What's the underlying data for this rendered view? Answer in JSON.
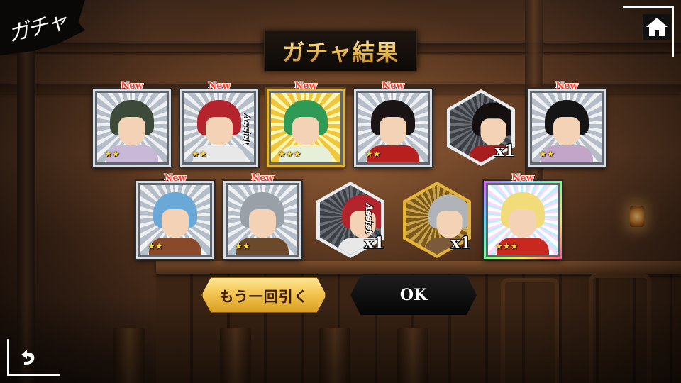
{
  "screen": {
    "title": "ガチャ",
    "results_title": "ガチャ結果"
  },
  "nav": {
    "home_icon": "home-icon",
    "back_icon": "back-arrow-icon"
  },
  "colors": {
    "gold": "#e2b53a",
    "new_badge": "#ff3a2a",
    "star": "#ffd53a"
  },
  "row1": [
    {
      "kind": "card",
      "new": "New",
      "stars": "★★",
      "rarity": "silver",
      "hair": "#3d4a3a",
      "body": "#c9b8d8",
      "assist": ""
    },
    {
      "kind": "card",
      "new": "New",
      "stars": "★★",
      "rarity": "silver",
      "hair": "#b4242c",
      "body": "#e8e8e8",
      "assist": "Assist"
    },
    {
      "kind": "card",
      "new": "New",
      "stars": "★★★",
      "rarity": "gold",
      "hair": "#2f9a55",
      "body": "#e6f0d8",
      "assist": ""
    },
    {
      "kind": "card",
      "new": "New",
      "stars": "★★",
      "rarity": "silver",
      "hair": "#1a1414",
      "body": "#b82020",
      "assist": ""
    },
    {
      "kind": "hex",
      "count": "x1",
      "rarity": "silver",
      "hair": "#141010",
      "body": "#a81e1e"
    },
    {
      "kind": "card",
      "new": "New",
      "stars": "★★",
      "rarity": "silver",
      "hair": "#151515",
      "body": "#c2a5c8",
      "assist": ""
    }
  ],
  "row2": [
    {
      "kind": "card",
      "new": "New",
      "stars": "★★",
      "rarity": "silver",
      "hair": "#6aa8d8",
      "body": "#8a4a2a",
      "assist": ""
    },
    {
      "kind": "card",
      "new": "New",
      "stars": "★★",
      "rarity": "silver",
      "hair": "#9aa0a8",
      "body": "#6a4a2a",
      "assist": ""
    },
    {
      "kind": "hex",
      "count": "x1",
      "rarity": "silver",
      "hair": "#b4242c",
      "body": "#e8e8e8",
      "assist": "Assist"
    },
    {
      "kind": "hex",
      "count": "x1",
      "rarity": "gold",
      "hair": "#b0b4b8",
      "body": "#7a5a3a"
    },
    {
      "kind": "card",
      "new": "New",
      "stars": "★★★",
      "rarity": "rainbow",
      "hair": "#f2dc7a",
      "body": "#c8281e",
      "assist": ""
    }
  ],
  "buttons": {
    "again": "もう一回引く",
    "ok": "OK"
  }
}
